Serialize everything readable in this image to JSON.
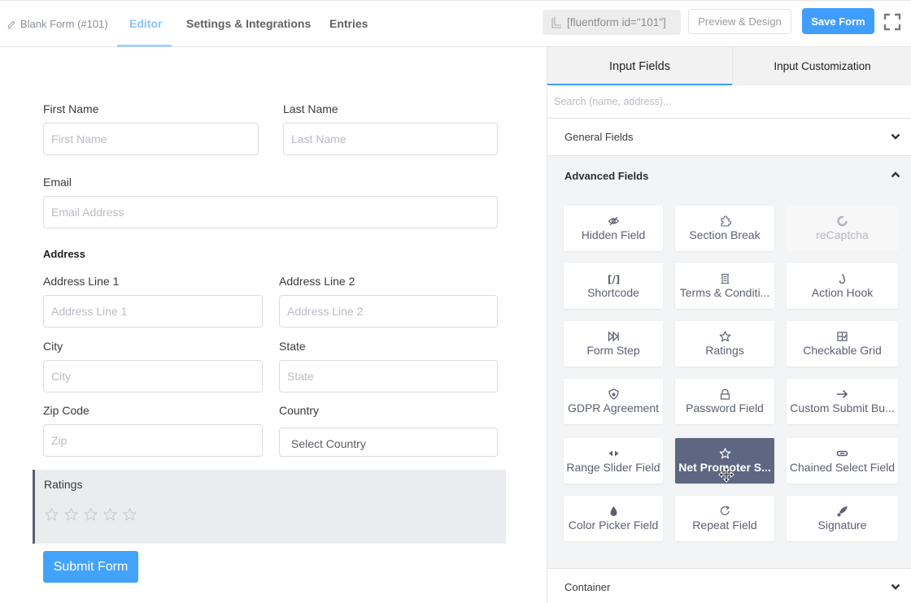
{
  "topbar": {
    "form_title": "Blank Form (#101)",
    "tabs": [
      {
        "label": "Editor",
        "active": true
      },
      {
        "label": "Settings & Integrations",
        "active": false
      },
      {
        "label": "Entries",
        "active": false
      }
    ],
    "shortcode": "[fluentform id=\"101\"]",
    "preview_label": "Preview & Design",
    "save_label": "Save Form"
  },
  "form": {
    "first_name": {
      "label": "First Name",
      "placeholder": "First Name"
    },
    "last_name": {
      "label": "Last Name",
      "placeholder": "Last Name"
    },
    "email": {
      "label": "Email",
      "placeholder": "Email Address"
    },
    "address": {
      "heading": "Address",
      "line1": {
        "label": "Address Line 1",
        "placeholder": "Address Line 1"
      },
      "line2": {
        "label": "Address Line 2",
        "placeholder": "Address Line 2"
      },
      "city": {
        "label": "City",
        "placeholder": "City"
      },
      "state": {
        "label": "State",
        "placeholder": "State"
      },
      "zip": {
        "label": "Zip Code",
        "placeholder": "Zip"
      },
      "country": {
        "label": "Country",
        "value": "Select Country"
      }
    },
    "ratings": {
      "label": "Ratings",
      "max_stars": 5,
      "value": 0
    },
    "submit_label": "Submit Form"
  },
  "panel": {
    "tabs": [
      {
        "label": "Input Fields",
        "active": true
      },
      {
        "label": "Input Customization",
        "active": false
      }
    ],
    "search_placeholder": "Search (name, address)...",
    "sections": {
      "general": {
        "label": "General Fields",
        "expanded": false
      },
      "advanced": {
        "label": "Advanced Fields",
        "expanded": true
      },
      "container": {
        "label": "Container",
        "expanded": false
      }
    },
    "advanced_fields": [
      {
        "label": "Hidden Field",
        "icon": "eye-slash-icon"
      },
      {
        "label": "Section Break",
        "icon": "puzzle-icon"
      },
      {
        "label": "reCaptcha",
        "icon": "recaptcha-icon",
        "disabled": true
      },
      {
        "label": "Shortcode",
        "icon": "shortcode-icon"
      },
      {
        "label": "Terms & Conditi...",
        "icon": "scroll-icon"
      },
      {
        "label": "Action Hook",
        "icon": "hook-icon"
      },
      {
        "label": "Form Step",
        "icon": "step-forward-icon"
      },
      {
        "label": "Ratings",
        "icon": "star-icon"
      },
      {
        "label": "Checkable Grid",
        "icon": "grid-check-icon"
      },
      {
        "label": "GDPR Agreement",
        "icon": "shield-icon"
      },
      {
        "label": "Password Field",
        "icon": "lock-icon"
      },
      {
        "label": "Custom Submit Bu...",
        "icon": "arrow-right-icon"
      },
      {
        "label": "Range Slider Field",
        "icon": "range-arrows-icon"
      },
      {
        "label": "Net Promoter S...",
        "icon": "star-icon",
        "selected": true
      },
      {
        "label": "Chained Select Field",
        "icon": "link-icon"
      },
      {
        "label": "Color Picker Field",
        "icon": "droplet-icon"
      },
      {
        "label": "Repeat Field",
        "icon": "repeat-icon"
      },
      {
        "label": "Signature",
        "icon": "feather-icon"
      }
    ]
  }
}
